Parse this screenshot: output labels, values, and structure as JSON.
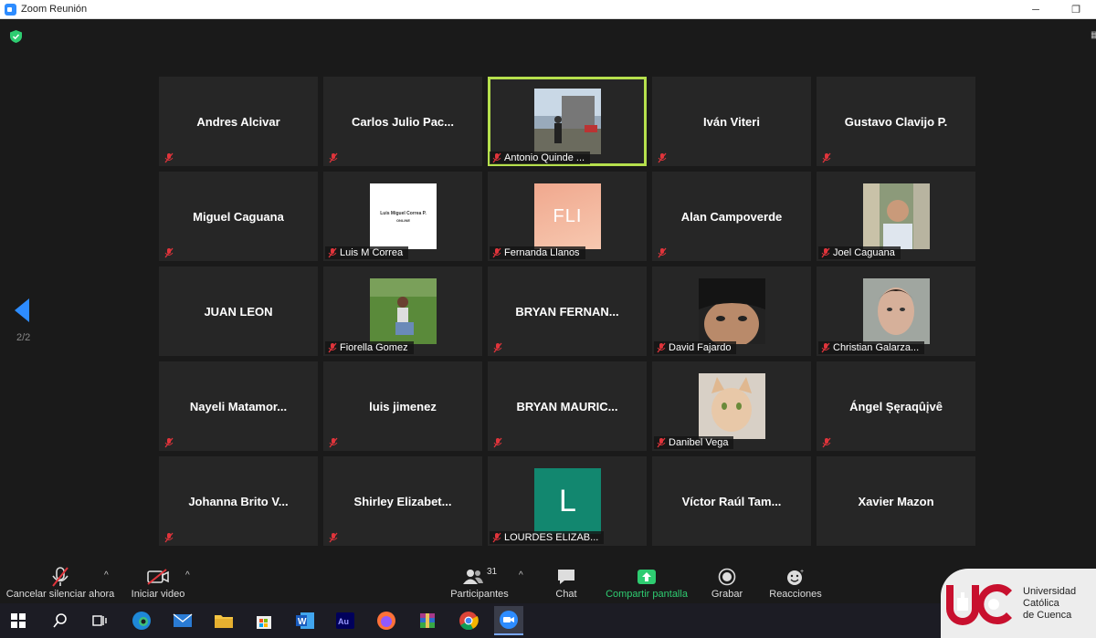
{
  "window": {
    "title": "Zoom Reunión"
  },
  "pager": {
    "indicator": "2/2"
  },
  "tiles": [
    {
      "name": "Andres Alcivar",
      "label": ""
    },
    {
      "name": "Carlos  Julio  Pac...",
      "label": ""
    },
    {
      "name": "",
      "label": "Antonio Quinde ..."
    },
    {
      "name": "Iván Viteri",
      "label": ""
    },
    {
      "name": "Gustavo Clavijo P.",
      "label": ""
    },
    {
      "name": "Miguel Caguana",
      "label": ""
    },
    {
      "name": "",
      "label": "Luis M Correa"
    },
    {
      "name": "",
      "label": "Fernanda Llanos"
    },
    {
      "name": "Alan Campoverde",
      "label": ""
    },
    {
      "name": "",
      "label": "Joel Caguana"
    },
    {
      "name": "JUAN LEON",
      "label": ""
    },
    {
      "name": "",
      "label": "Fiorella Gomez"
    },
    {
      "name": "BRYAN FERNAN...",
      "label": ""
    },
    {
      "name": "",
      "label": "David Fajardo"
    },
    {
      "name": "",
      "label": "Christian Galarza..."
    },
    {
      "name": "Nayeli  Matamor...",
      "label": ""
    },
    {
      "name": "luis jimenez",
      "label": ""
    },
    {
      "name": "BRYAN MAURIC...",
      "label": ""
    },
    {
      "name": "",
      "label": "Danibel Vega"
    },
    {
      "name": "Ángel  Șęraqûįvê",
      "label": ""
    },
    {
      "name": "Johanna Brito V...",
      "label": ""
    },
    {
      "name": "Shirley  Elizabet...",
      "label": ""
    },
    {
      "name": "",
      "label": "LOURDES ELIZAB..."
    },
    {
      "name": "Víctor Raúl Tam...",
      "label": ""
    },
    {
      "name": "Xavier Mazon",
      "label": ""
    }
  ],
  "avatars": {
    "fernanda": "FLI",
    "lourdes": "L",
    "luis_card_line1": "Luis Miguel Correa P.",
    "luis_card_line2": "ONLINE"
  },
  "toolbar": {
    "mute": "Cancelar silenciar ahora",
    "video": "Iniciar video",
    "participants": "Participantes",
    "participants_count": "31",
    "chat": "Chat",
    "share": "Compartir pantalla",
    "record": "Grabar",
    "reactions": "Reacciones"
  },
  "brand": {
    "line1": "Universidad",
    "line2": "Católica",
    "line3": "de Cuenca"
  },
  "colors": {
    "active_speaker": "#b6e04d",
    "share": "#2ecc71",
    "zoom_blue": "#2d8cff",
    "mute_red": "#e0343b"
  }
}
